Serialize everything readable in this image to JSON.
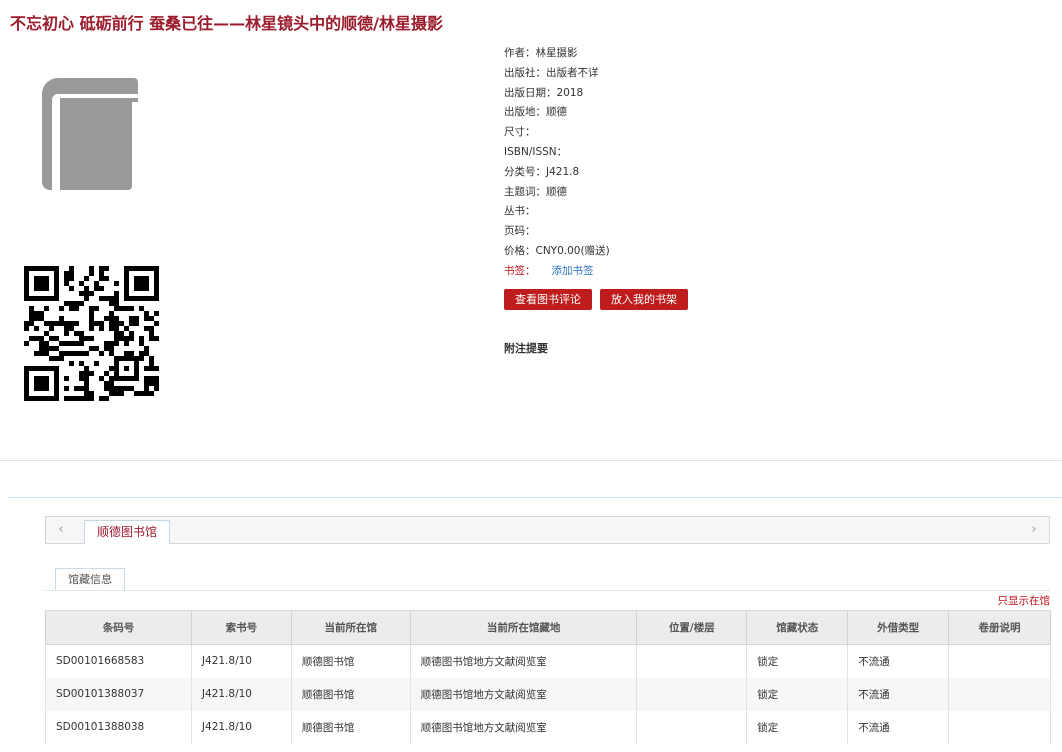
{
  "title": "不忘初心 砥砺前行 蚕桑已往——林星镜头中的顺德/林星摄影",
  "meta": [
    {
      "label": "作者：",
      "value": "林星摄影"
    },
    {
      "label": "出版社：",
      "value": "出版者不详"
    },
    {
      "label": "出版日期：",
      "value": "2018"
    },
    {
      "label": "出版地：",
      "value": "顺德"
    },
    {
      "label": "尺寸：",
      "value": ""
    },
    {
      "label": "ISBN/ISSN：",
      "value": ""
    },
    {
      "label": "分类号：",
      "value": "J421.8"
    },
    {
      "label": "主题词：",
      "value": "顺德"
    },
    {
      "label": "丛书：",
      "value": ""
    },
    {
      "label": "页码：",
      "value": ""
    },
    {
      "label": "价格：",
      "value": "CNY0.00(赠送)"
    }
  ],
  "bookmark": {
    "label": "书签：",
    "link": "添加书签"
  },
  "buttons": {
    "reviews": "查看图书评论",
    "shelf": "放入我的书架"
  },
  "notes_heading": "附注提要",
  "library_tab": "顺德图书馆",
  "arrows": {
    "left": "‹",
    "right": "›"
  },
  "holding_tab": "馆藏信息",
  "only_available": "只显示在馆",
  "table": {
    "headers": [
      "条码号",
      "索书号",
      "当前所在馆",
      "当前所在馆藏地",
      "位置/楼层",
      "馆藏状态",
      "外借类型",
      "卷册说明"
    ],
    "rows": [
      [
        "SD00101668583",
        "J421.8/10",
        "顺德图书馆",
        "顺德图书馆地方文献阅览室",
        "",
        "锁定",
        "不流通",
        ""
      ],
      [
        "SD00101388037",
        "J421.8/10",
        "顺德图书馆",
        "顺德图书馆地方文献阅览室",
        "",
        "锁定",
        "不流通",
        ""
      ],
      [
        "SD00101388038",
        "J421.8/10",
        "顺德图书馆",
        "顺德图书馆地方文献阅览室",
        "",
        "锁定",
        "不流通",
        ""
      ]
    ]
  },
  "colors": {
    "title": "#9b1c2c",
    "button": "#bf1d1d",
    "link": "#2a73c6",
    "cover": "#999999"
  },
  "icons": {
    "cover": "book-cover-icon",
    "qr": "qr-code-icon"
  }
}
